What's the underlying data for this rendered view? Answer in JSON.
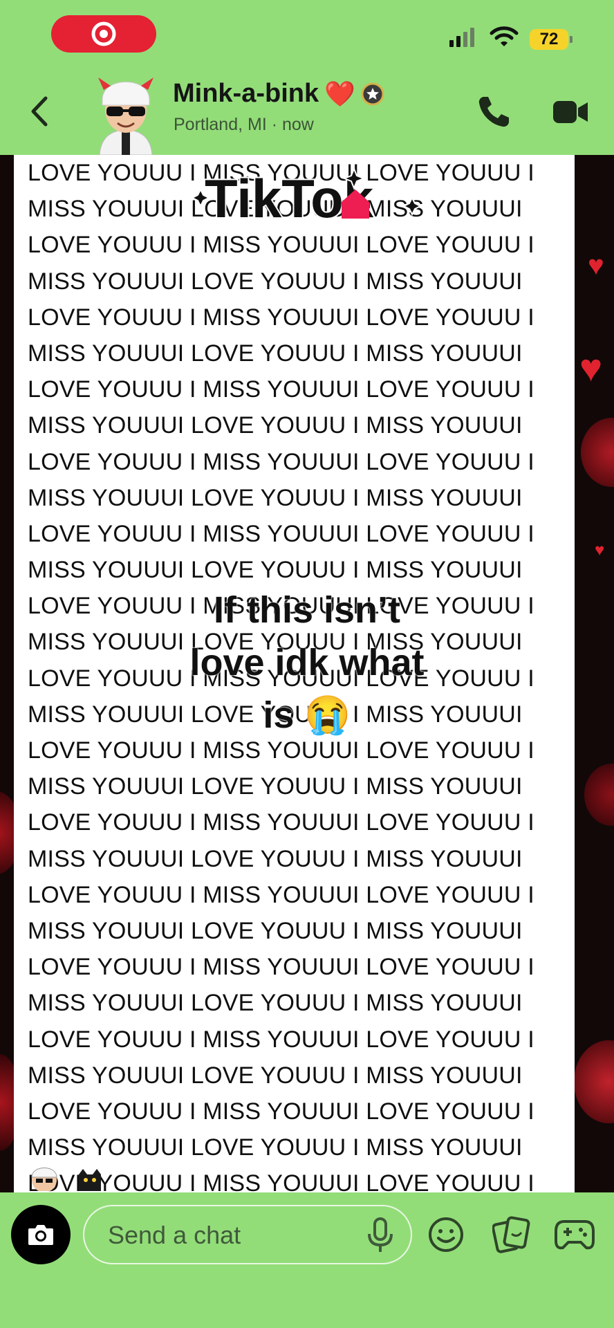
{
  "status_bar": {
    "battery": "72"
  },
  "header": {
    "contact_name": "Mink-a-bink",
    "heart_emoji": "❤️",
    "location_status": "Portland, MI · now"
  },
  "message": {
    "text_lines": [
      "LOVE YOUUU I MISS YOUUUI LOVE YOUUU I",
      "MISS YOUUUI LOVE YOUUU I MISS YOUUUI",
      "LOVE YOUUU I MISS YOUUUI LOVE YOUUU I",
      "MISS YOUUUI LOVE YOUUU I MISS YOUUUI",
      "LOVE YOUUU I MISS YOUUUI LOVE YOUUU I",
      "MISS YOUUUI LOVE YOUUU I MISS YOUUUI",
      "LOVE YOUUU I MISS YOUUUI LOVE YOUUU I",
      "MISS YOUUUI LOVE YOUUU I MISS YOUUUI",
      "LOVE YOUUU I MISS YOUUUI LOVE YOUUU I",
      "MISS YOUUUI LOVE YOUUU I MISS YOUUUI",
      "LOVE YOUUU I MISS YOUUUI LOVE YOUUU I",
      "MISS YOUUUI LOVE YOUUU I MISS YOUUUI",
      "LOVE YOUUU I MISS YOUUUI LOVE YOUUU I",
      "MISS YOUUUI LOVE YOUUU I MISS YOUUUI",
      "LOVE YOUUU I MISS YOUUUI LOVE YOUUU I",
      "MISS YOUUUI LOVE YOUUU I MISS YOUUUI",
      "LOVE YOUUU I MISS YOUUUI LOVE YOUUU I",
      "MISS YOUUUI LOVE YOUUU I MISS YOUUUI",
      "LOVE YOUUU I MISS YOUUUI LOVE YOUUU I",
      "MISS YOUUUI LOVE YOUUU I MISS YOUUUI",
      "LOVE YOUUU I MISS YOUUUI LOVE YOUUU I",
      "MISS YOUUUI LOVE YOUUU I MISS YOUUUI",
      "LOVE YOUUU I MISS YOUUUI LOVE YOUUU I",
      "MISS YOUUUI LOVE YOUUU I MISS YOUUUI",
      "LOVE YOUUU I MISS YOUUUI LOVE YOUUU I",
      "MISS YOUUUI LOVE YOUUU I MISS YOUUUI",
      "LOVE YOUUU I MISS YOUUUI LOVE YOUUU I",
      "MISS YOUUUI LOVE YOUUU I MISS YOUUUI",
      "LOVE YOUUU I MISS YOUUUI LOVE YOUUU I"
    ],
    "overlay_line1": "If this isn’t",
    "overlay_line2": "love idk what",
    "overlay_line3": "is 😭",
    "watermark": "TikTok"
  },
  "composer": {
    "placeholder": "Send a chat"
  },
  "colors": {
    "snap_green": "#93dd79",
    "pill_red": "#e52134",
    "battery_yellow": "#f5d32a"
  },
  "icons": [
    "record-pill-icon",
    "signal-icon",
    "wifi-icon",
    "back-chevron-icon",
    "bitmoji-avatar",
    "star-badge-icon",
    "phone-icon",
    "video-icon",
    "camera-icon",
    "mic-icon",
    "emoji-icon",
    "stickers-icon",
    "games-icon"
  ]
}
